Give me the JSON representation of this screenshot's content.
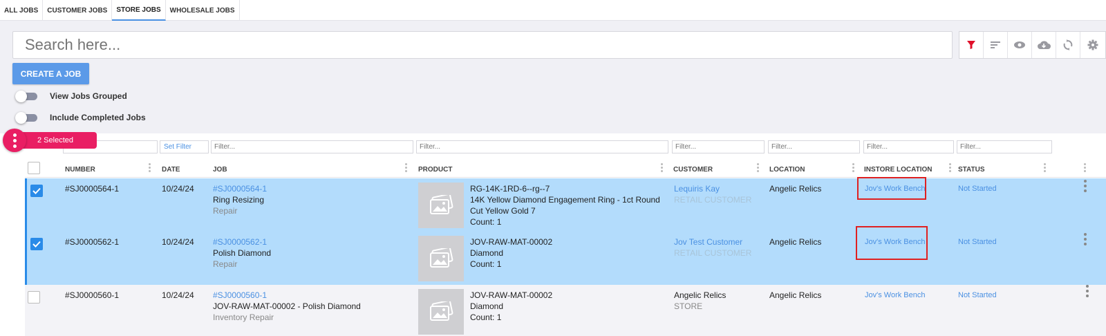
{
  "tabs": [
    "ALL JOBS",
    "CUSTOMER JOBS",
    "STORE JOBS",
    "WHOLESALE JOBS"
  ],
  "search": {
    "placeholder": "Search here..."
  },
  "toolbar_icons": [
    "filter-icon",
    "sort-icon",
    "eye-icon",
    "cloud-download-icon",
    "refresh-icon",
    "gear-icon"
  ],
  "create_button": "CREATE A JOB",
  "toggles": {
    "grouped": "View Jobs Grouped",
    "completed": "Include Completed Jobs"
  },
  "selection": {
    "label": "2 Selected"
  },
  "filters": {
    "placeholder": "Filter...",
    "set_filter": "Set Filter"
  },
  "columns": {
    "number": "NUMBER",
    "date": "DATE",
    "job": "JOB",
    "product": "PRODUCT",
    "customer": "CUSTOMER",
    "location": "LOCATION",
    "instore": "INSTORE LOCATION",
    "status": "STATUS"
  },
  "rows": [
    {
      "number": "#SJ0000564-1",
      "date": "10/24/24",
      "job_link": "#SJ0000564-1",
      "job_name": "Ring Resizing",
      "job_type": "Repair",
      "product_sku": "RG-14K-1RD-6--rg--7",
      "product_line1": "14K Yellow Diamond Engagement Ring - 1ct Round",
      "product_line2": "Cut Yellow Gold 7",
      "product_count": "Count: 1",
      "customer": "Lequiris Kay",
      "customer_type": "RETAIL CUSTOMER",
      "location": "Angelic Relics",
      "instore": "Jov's Work Bench",
      "status": "Not Started"
    },
    {
      "number": "#SJ0000562-1",
      "date": "10/24/24",
      "job_link": "#SJ0000562-1",
      "job_name": "Polish Diamond",
      "job_type": "Repair",
      "product_sku": "JOV-RAW-MAT-00002",
      "product_line1": "Diamond",
      "product_count": "Count: 1",
      "customer": "Jov Test Customer",
      "customer_type": "RETAIL CUSTOMER",
      "location": "Angelic Relics",
      "instore": "Jov's Work Bench",
      "status": "Not Started"
    },
    {
      "number": "#SJ0000560-1",
      "date": "10/24/24",
      "job_link": "#SJ0000560-1",
      "job_name": "JOV-RAW-MAT-00002 - Polish Diamond",
      "job_type": "Inventory Repair",
      "product_sku": "JOV-RAW-MAT-00002",
      "product_line1": "Diamond",
      "product_count": "Count: 1",
      "customer": "Angelic Relics",
      "customer_type": "STORE",
      "location": "Angelic Relics",
      "instore": "Jov's Work Bench",
      "status": "Not Started"
    }
  ],
  "colors": {
    "accent": "#4a90e2",
    "selection": "#e91e63",
    "row_selected": "#b3dcfc",
    "highlight_box": "#e02020"
  }
}
